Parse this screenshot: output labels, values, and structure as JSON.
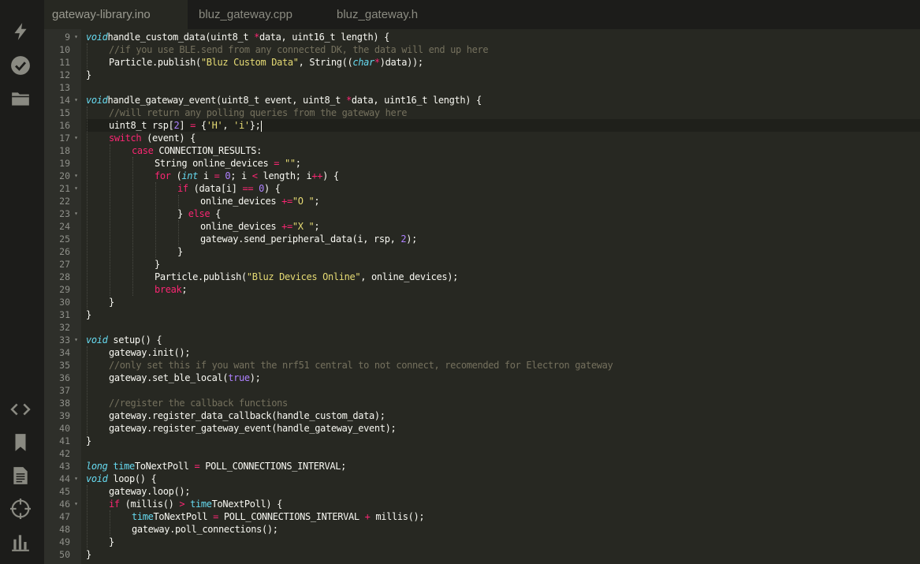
{
  "tabs": [
    {
      "label": "gateway-library.ino",
      "active": true
    },
    {
      "label": "bluz_gateway.cpp",
      "active": false
    },
    {
      "label": "bluz_gateway.h",
      "active": false
    }
  ],
  "sidebar": {
    "top_icons": [
      "flash-icon",
      "verify-icon",
      "folder-icon"
    ],
    "bottom_icons": [
      "code-icon",
      "bookmark-icon",
      "document-icon",
      "target-icon",
      "chart-icon"
    ]
  },
  "editor": {
    "highlight_line": 16,
    "lines": [
      {
        "n": "9",
        "fold": true,
        "ind": 0,
        "tokens": [
          [
            "ty",
            "void"
          ],
          [
            "",
            "handle_custom_data(uint8_t "
          ],
          [
            "op",
            "*"
          ],
          [
            "",
            "data, uint16_t length) {"
          ]
        ]
      },
      {
        "n": "10",
        "ind": 1,
        "tokens": [
          [
            "cm",
            "//if you use BLE.send from any connected DK, the data will end up here"
          ]
        ]
      },
      {
        "n": "11",
        "ind": 1,
        "tokens": [
          [
            "",
            "Particle.publish("
          ],
          [
            "st",
            "\"Bluz Custom Data\""
          ],
          [
            "",
            ", String(("
          ],
          [
            "ty",
            "char"
          ],
          [
            "op",
            "*"
          ],
          [
            "",
            ")data));"
          ]
        ]
      },
      {
        "n": "12",
        "ind": 0,
        "tokens": [
          [
            "",
            "}"
          ]
        ]
      },
      {
        "n": "13",
        "ind": 0,
        "tokens": []
      },
      {
        "n": "14",
        "fold": true,
        "ind": 0,
        "tokens": [
          [
            "ty",
            "void"
          ],
          [
            "",
            "handle_gateway_event(uint8_t event, uint8_t "
          ],
          [
            "op",
            "*"
          ],
          [
            "",
            "data, uint16_t length) {"
          ]
        ]
      },
      {
        "n": "15",
        "ind": 1,
        "tokens": [
          [
            "cm",
            "//will return any polling queries from the gateway here"
          ]
        ]
      },
      {
        "n": "16",
        "ind": 1,
        "caret": true,
        "tokens": [
          [
            "",
            "uint8_t rsp["
          ],
          [
            "nu",
            "2"
          ],
          [
            "",
            "] "
          ],
          [
            "op",
            "="
          ],
          [
            "",
            " {"
          ],
          [
            "st",
            "'H'"
          ],
          [
            "",
            ", "
          ],
          [
            "st",
            "'i'"
          ],
          [
            "",
            "};"
          ]
        ]
      },
      {
        "n": "17",
        "fold": true,
        "ind": 1,
        "tokens": [
          [
            "kw",
            "switch"
          ],
          [
            "",
            "",
            " (event) {"
          ]
        ]
      },
      {
        "n": "18",
        "ind": 2,
        "tokens": [
          [
            "kw",
            "case"
          ],
          [
            "",
            " CONNECTION_RESULTS:"
          ]
        ]
      },
      {
        "n": "19",
        "ind": 3,
        "tokens": [
          [
            "",
            "String online_devices "
          ],
          [
            "op",
            "="
          ],
          [
            "",
            " "
          ],
          [
            "st",
            "\"\""
          ],
          [
            "",
            ";"
          ]
        ]
      },
      {
        "n": "20",
        "fold": true,
        "ind": 3,
        "tokens": [
          [
            "kw",
            "for"
          ],
          [
            "",
            " ("
          ],
          [
            "ty",
            "int"
          ],
          [
            "",
            " i "
          ],
          [
            "op",
            "="
          ],
          [
            "",
            " "
          ],
          [
            "nu",
            "0"
          ],
          [
            "",
            "; i "
          ],
          [
            "op",
            "<"
          ],
          [
            "",
            " length; i"
          ],
          [
            "op",
            "++"
          ],
          [
            "",
            ") {"
          ]
        ]
      },
      {
        "n": "21",
        "fold": true,
        "ind": 4,
        "tokens": [
          [
            "kw",
            "if"
          ],
          [
            "",
            " (data[i] "
          ],
          [
            "op",
            "=="
          ],
          [
            "",
            " "
          ],
          [
            "nu",
            "0"
          ],
          [
            "",
            ") {"
          ]
        ]
      },
      {
        "n": "22",
        "ind": 5,
        "tokens": [
          [
            "",
            "online_devices "
          ],
          [
            "op",
            "+="
          ],
          [
            "st",
            "\"O \""
          ],
          [
            "",
            ";"
          ]
        ]
      },
      {
        "n": "23",
        "fold": true,
        "ind": 4,
        "tokens": [
          [
            "",
            "} "
          ],
          [
            "kw",
            "else"
          ],
          [
            "",
            " {"
          ]
        ]
      },
      {
        "n": "24",
        "ind": 5,
        "tokens": [
          [
            "",
            "online_devices "
          ],
          [
            "op",
            "+="
          ],
          [
            "st",
            "\"X \""
          ],
          [
            "",
            ";"
          ]
        ]
      },
      {
        "n": "25",
        "ind": 5,
        "tokens": [
          [
            "",
            "gateway.send_peripheral_data(i, rsp, "
          ],
          [
            "nu",
            "2"
          ],
          [
            "",
            ");"
          ]
        ]
      },
      {
        "n": "26",
        "ind": 4,
        "tokens": [
          [
            "",
            "}"
          ]
        ]
      },
      {
        "n": "27",
        "ind": 3,
        "tokens": [
          [
            "",
            "}"
          ]
        ]
      },
      {
        "n": "28",
        "ind": 3,
        "tokens": [
          [
            "",
            "Particle.publish("
          ],
          [
            "st",
            "\"Bluz Devices Online\""
          ],
          [
            "",
            ", online_devices);"
          ]
        ]
      },
      {
        "n": "29",
        "ind": 3,
        "tokens": [
          [
            "kw",
            "break"
          ],
          [
            "",
            ";"
          ]
        ]
      },
      {
        "n": "30",
        "ind": 1,
        "tokens": [
          [
            "",
            "}"
          ]
        ]
      },
      {
        "n": "31",
        "ind": 0,
        "tokens": [
          [
            "",
            "}"
          ]
        ]
      },
      {
        "n": "32",
        "ind": 0,
        "tokens": []
      },
      {
        "n": "33",
        "fold": true,
        "ind": 0,
        "tokens": [
          [
            "ty",
            "void"
          ],
          [
            "",
            " setup() {"
          ]
        ]
      },
      {
        "n": "34",
        "ind": 1,
        "tokens": [
          [
            "",
            "gateway.init();"
          ]
        ]
      },
      {
        "n": "35",
        "ind": 1,
        "tokens": [
          [
            "cm",
            "//only set this if you want the nrf51 central to not connect, recomended for Electron gateway"
          ]
        ]
      },
      {
        "n": "36",
        "ind": 1,
        "tokens": [
          [
            "",
            "gateway.set_ble_local("
          ],
          [
            "nu",
            "true"
          ],
          [
            "",
            ");"
          ]
        ]
      },
      {
        "n": "37",
        "ind": 0,
        "tokens": []
      },
      {
        "n": "38",
        "ind": 1,
        "tokens": [
          [
            "cm",
            "//register the callback functions"
          ]
        ]
      },
      {
        "n": "39",
        "ind": 1,
        "tokens": [
          [
            "",
            "gateway.register_data_callback(handle_custom_data);"
          ]
        ]
      },
      {
        "n": "40",
        "ind": 1,
        "tokens": [
          [
            "",
            "gateway.register_gateway_event(handle_gateway_event);"
          ]
        ]
      },
      {
        "n": "41",
        "ind": 0,
        "tokens": [
          [
            "",
            "}"
          ]
        ]
      },
      {
        "n": "42",
        "ind": 0,
        "tokens": []
      },
      {
        "n": "43",
        "ind": 0,
        "tokens": [
          [
            "ty",
            "long"
          ],
          [
            "",
            " "
          ],
          [
            "va",
            "time"
          ],
          [
            "",
            "ToNextPoll "
          ],
          [
            "op",
            "="
          ],
          [
            "",
            " POLL_CONNECTIONS_INTERVAL;"
          ]
        ]
      },
      {
        "n": "44",
        "fold": true,
        "ind": 0,
        "tokens": [
          [
            "ty",
            "void"
          ],
          [
            "",
            " loop() {"
          ]
        ]
      },
      {
        "n": "45",
        "ind": 1,
        "tokens": [
          [
            "",
            "gateway.loop();"
          ]
        ]
      },
      {
        "n": "46",
        "fold": true,
        "ind": 1,
        "tokens": [
          [
            "kw",
            "if"
          ],
          [
            "",
            " (millis() "
          ],
          [
            "op",
            ">"
          ],
          [
            "",
            " "
          ],
          [
            "va",
            "time"
          ],
          [
            "",
            "ToNextPoll) {"
          ]
        ]
      },
      {
        "n": "47",
        "ind": 2,
        "tokens": [
          [
            "va",
            "time"
          ],
          [
            "",
            "ToNextPoll "
          ],
          [
            "op",
            "="
          ],
          [
            "",
            " POLL_CONNECTIONS_INTERVAL "
          ],
          [
            "op",
            "+"
          ],
          [
            "",
            " millis();"
          ]
        ]
      },
      {
        "n": "48",
        "ind": 2,
        "tokens": [
          [
            "",
            "gateway.poll_connections();"
          ]
        ]
      },
      {
        "n": "49",
        "ind": 1,
        "tokens": [
          [
            "",
            "}"
          ]
        ]
      },
      {
        "n": "50",
        "ind": 0,
        "tokens": [
          [
            "",
            "}"
          ]
        ]
      }
    ]
  }
}
